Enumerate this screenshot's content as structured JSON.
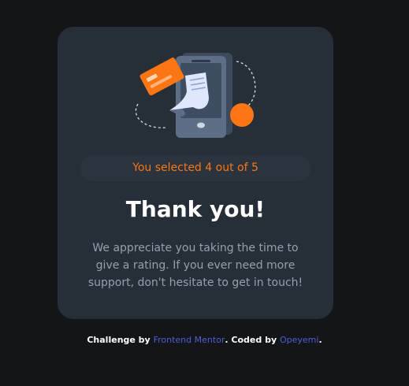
{
  "card": {
    "icon": "payment-illustration",
    "selection_text": "You selected 4 out of 5",
    "title": "Thank you!",
    "message": "We appreciate you taking the time to give a rating. If you ever need more support, don't hesitate to get in touch!"
  },
  "attribution": {
    "prefix": "Challenge by ",
    "link1": "Frontend Mentor",
    "middle": ". Coded by ",
    "link2": "Opeyemi",
    "suffix": "."
  },
  "colors": {
    "background": "#131518",
    "card": "#262e38",
    "accent": "#fc7614",
    "link": "#4f5fd1"
  }
}
